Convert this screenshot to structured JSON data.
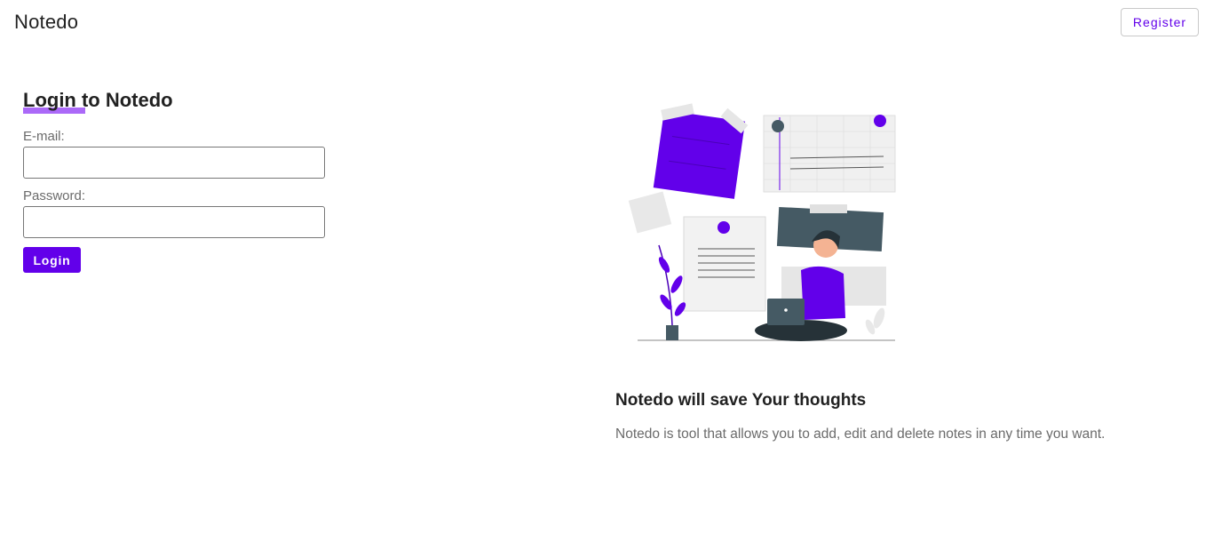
{
  "header": {
    "app_title": "Notedo",
    "register_label": "Register"
  },
  "login": {
    "heading": "Login to Notedo",
    "email_label": "E-mail:",
    "email_value": "",
    "password_label": "Password:",
    "password_value": "",
    "submit_label": "Login"
  },
  "info": {
    "heading": "Notedo will save Your thoughts",
    "description": "Notedo is tool that allows you to add, edit and delete notes in any time you want."
  },
  "colors": {
    "accent": "#6200ea",
    "underline": "#a259f7",
    "dark_slate": "#455a64"
  },
  "icons": {
    "illustration": "notes-illustration"
  }
}
